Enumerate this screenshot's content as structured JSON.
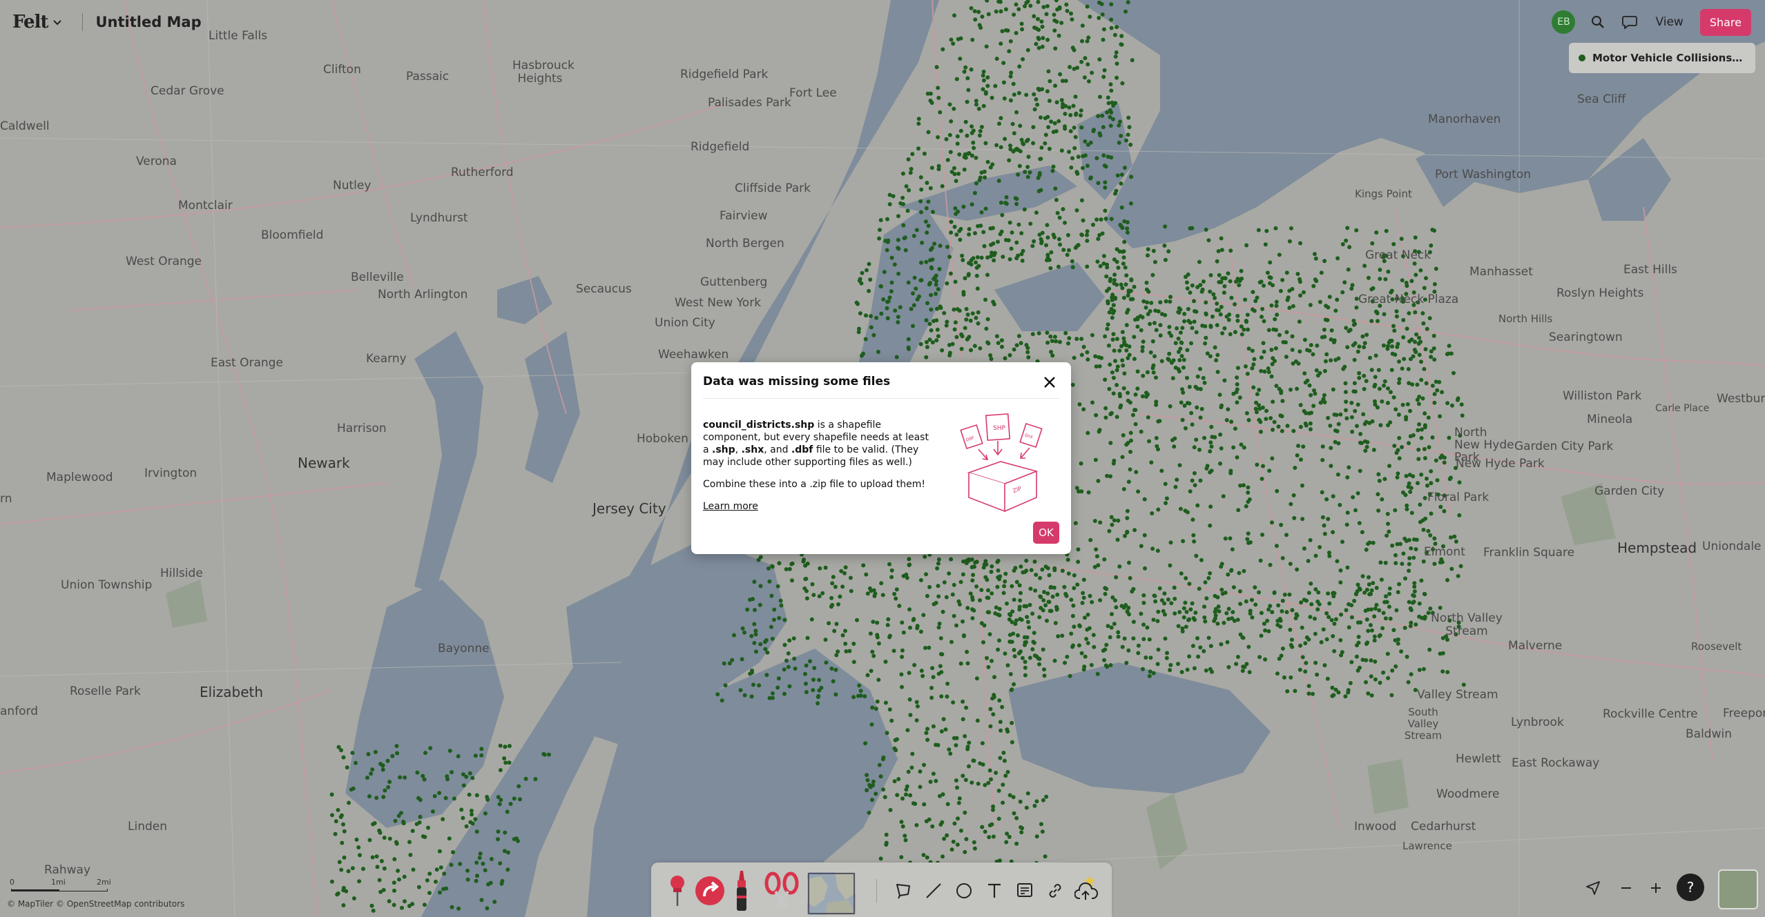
{
  "app": {
    "logo": "Felt",
    "map_title": "Untitled Map"
  },
  "topbar": {
    "avatar_initials": "EB",
    "view_label": "View",
    "share_label": "Share"
  },
  "layer": {
    "name": "Motor Vehicle Collisions Augu..."
  },
  "dialog": {
    "title": "Data was missing some files",
    "filename": "council_districts.shp",
    "text_a": " is a shapefile component, but every shapefile needs at least a ",
    "ext_shp": ".shp",
    "comma": ", ",
    "ext_shx": ".shx",
    "and": ", and ",
    "ext_dbf": ".dbf",
    "text_b": " file to be valid. (They may include other supporting files as well.)",
    "combine": "Combine these into a .zip file to upload them!",
    "learn_more": "Learn more",
    "ok_label": "OK",
    "illustration_labels": {
      "shp": "SHP",
      "zip": "ZIP",
      "side_left": "DBF",
      "side_right": "SHX"
    }
  },
  "scale": {
    "zero": "0",
    "one": "1mi",
    "two": "2mi"
  },
  "attribution": "© MapTiler  © OpenStreetMap contributors",
  "map_labels": {
    "little_falls": "Little Falls",
    "clifton": "Clifton",
    "passaic": "Passaic",
    "hasbrouck": "Hasbrouck Heights",
    "ridgefield_park": "Ridgefield Park",
    "fort_lee": "Fort Lee",
    "palisades_park": "Palisades Park",
    "cedar_grove": "Cedar Grove",
    "caldwell": "Caldwell",
    "verona": "Verona",
    "nutley": "Nutley",
    "rutherford": "Rutherford",
    "ridgefield": "Ridgefield",
    "cliffside": "Cliffside Park",
    "montclair": "Montclair",
    "lyndhurst": "Lyndhurst",
    "fairview": "Fairview",
    "bloomfield": "Bloomfield",
    "north_bergen": "North Bergen",
    "west_orange": "West Orange",
    "belleville": "Belleville",
    "guttenberg": "Guttenberg",
    "secaucus": "Secaucus",
    "north_arlington": "North Arlington",
    "west_new_york": "West New York",
    "union_city": "Union City",
    "weehawken": "Weehawken",
    "east_orange": "East Orange",
    "kearny": "Kearny",
    "harrison": "Harrison",
    "hoboken": "Hoboken",
    "newark": "Newark",
    "irvington": "Irvington",
    "maplewood": "Maplewood",
    "jersey_city": "Jersey City",
    "hillside": "Hillside",
    "union_township": "Union Township",
    "bayonne": "Bayonne",
    "elizabeth": "Elizabeth",
    "roselle_park": "Roselle Park",
    "cranford": "anford",
    "linden": "Linden",
    "rahway": "Rahway",
    "orange_edge": "rn",
    "manorhaven": "Manorhaven",
    "sea_cliff": "Sea Cliff",
    "port_washington": "Port Washington",
    "kings_point": "Kings Point",
    "great_neck": "Great Neck",
    "manhasset": "Manhasset",
    "east_hills": "East Hills",
    "great_neck_plaza": "Great Neck Plaza",
    "roslyn_heights": "Roslyn Heights",
    "north_hills": "North Hills",
    "searingtown": "Searingtown",
    "williston_park": "Williston Park",
    "westbury": "Westbury",
    "carle_place": "Carle Place",
    "mineola": "Mineola",
    "north_new_hyde_park": "North New Hyde Park",
    "new_hyde_park": "New Hyde Park",
    "garden_city_park": "Garden City Park",
    "garden_city": "Garden City",
    "floral_park": "Floral Park",
    "hempstead": "Hempstead",
    "uniondale": "Uniondale",
    "elmont": "Elmont",
    "franklin_square": "Franklin Square",
    "north_valley_stream": "North Valley Stream",
    "malverne": "Malverne",
    "roosevelt": "Roosevelt",
    "valley_stream": "Valley Stream",
    "south_valley_stream": "South Valley Stream",
    "lynbrook": "Lynbrook",
    "rockville_centre": "Rockville Centre",
    "freeport": "Freeport",
    "baldwin": "Baldwin",
    "hewlett": "Hewlett",
    "east_rockaway": "East Rockaway",
    "woodmere": "Woodmere",
    "inwood": "Inwood",
    "cedarhurst": "Cedarhurst",
    "lawrence": "Lawrence"
  },
  "colors": {
    "accent": "#d63a6b",
    "dot": "#1e5d1e",
    "water": "#7d8b9b",
    "land": "#a8a9a4"
  },
  "icons": [
    "chevron-down-icon",
    "search-icon",
    "comment-icon",
    "close-icon",
    "pin-icon",
    "route-icon",
    "marker-icon",
    "scissors-icon",
    "image-icon",
    "lasso-icon",
    "line-icon",
    "circle-icon",
    "text-icon",
    "note-icon",
    "link-icon",
    "upload-icon",
    "navigate-icon",
    "minus-icon",
    "plus-icon",
    "help-icon"
  ]
}
